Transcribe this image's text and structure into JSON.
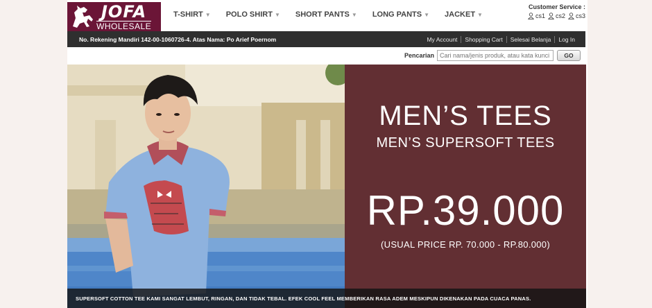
{
  "logo": {
    "main": "JOFA",
    "sub": "WHOLESALE"
  },
  "nav": [
    {
      "label": "T-SHIRT"
    },
    {
      "label": "POLO SHIRT"
    },
    {
      "label": "SHORT PANTS"
    },
    {
      "label": "LONG PANTS"
    },
    {
      "label": "JACKET"
    }
  ],
  "customer_service": {
    "title": "Customer Service :",
    "links": [
      "cs1",
      "cs2",
      "cs3"
    ]
  },
  "topbar": {
    "bank_info": "No. Rekening Mandiri 142-00-1060726-4. Atas Nama: Po Arief Poernomo",
    "links": [
      "My Account",
      "Shopping Cart",
      "Selesai Belanja",
      "Log In"
    ]
  },
  "search": {
    "label": "Pencarian",
    "placeholder": "Cari nama/jenis produk, atau kata kunci",
    "button": "GO"
  },
  "banner": {
    "title": "MEN’S TEES",
    "subtitle": "MEN’S SUPERSOFT TEES",
    "price": "RP.39.000",
    "usual_price": "(USUAL PRICE RP. 70.000 - RP.80.000)",
    "caption": "SUPERSOFT COTTON TEE KAMI SANGAT LEMBUT, RINGAN, DAN TIDAK TEBAL. EFEK COOL FEEL MEMBERIKAN RASA ADEM MESKIPUN DIKENAKAN PADA CUACA PANAS."
  },
  "colors": {
    "brand": "#6b1537",
    "panel": "#622f33",
    "topbar": "#2f2f2f"
  }
}
